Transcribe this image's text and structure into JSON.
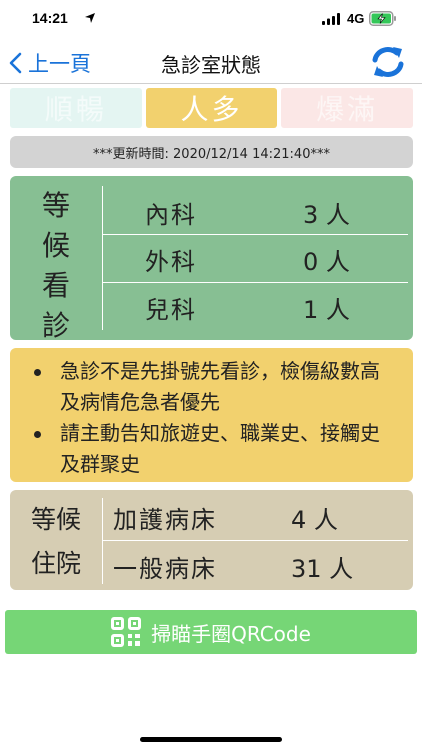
{
  "status_bar": {
    "time": "14:21",
    "network": "4G"
  },
  "nav": {
    "back_label": "上一頁",
    "title": "急診室狀態"
  },
  "crowd_levels": [
    {
      "label": "順暢",
      "active": false
    },
    {
      "label": "人多",
      "active": true
    },
    {
      "label": "爆滿",
      "active": false
    }
  ],
  "update_text": "***更新時間: 2020/12/14 14:21:40***",
  "waiting_panel": {
    "label_chars": [
      "等",
      "候",
      "看",
      "診"
    ],
    "departments": [
      {
        "name": "內科",
        "count": "3 人"
      },
      {
        "name": "外科",
        "count": "0 人"
      },
      {
        "name": "兒科",
        "count": "1 人"
      }
    ]
  },
  "notices": [
    "急診不是先掛號先看診，檢傷級數高及病情危急者優先",
    "請主動告知旅遊史、職業史、接觸史及群聚史"
  ],
  "inpatient_panel": {
    "label_lines": [
      "等候",
      "住院"
    ],
    "beds": [
      {
        "name": "加護病床",
        "count": "4 人"
      },
      {
        "name": "一般病床",
        "count": "31 人"
      }
    ]
  },
  "qr_button_label": "掃瞄手圈QRCode",
  "colors": {
    "accent_blue": "#1a73d9",
    "waiting_green": "#87bf93",
    "notice_yellow": "#f2d16e",
    "inpatient_tan": "#d6cdb3",
    "qr_green": "#76d676"
  }
}
